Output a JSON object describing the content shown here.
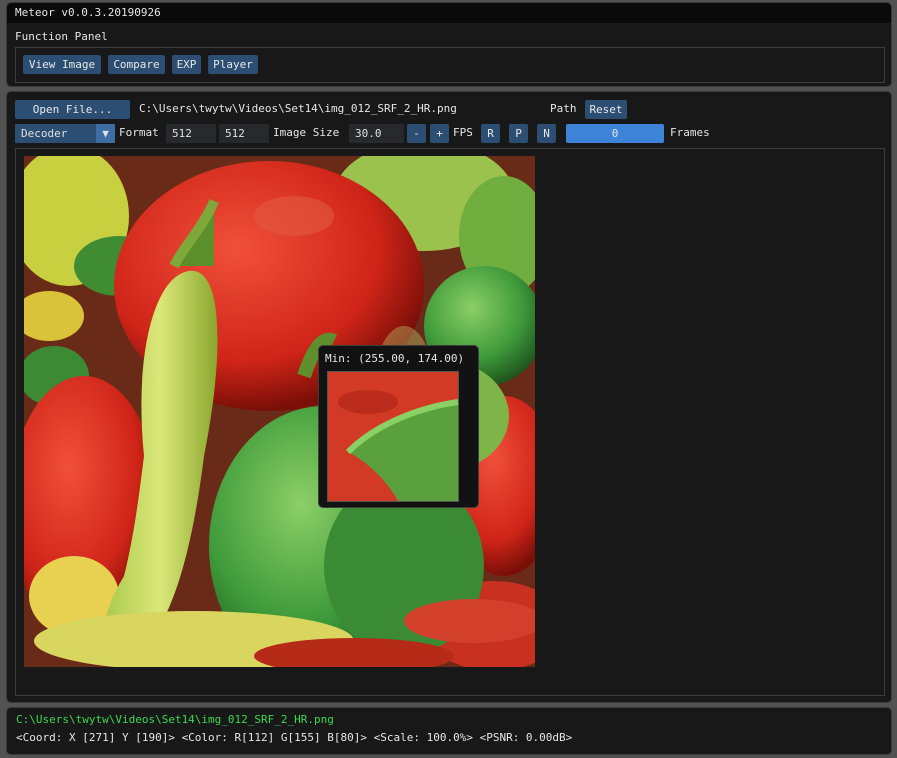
{
  "app": {
    "title": "Meteor v0.0.3.20190926"
  },
  "function_panel": {
    "label": "Function Panel",
    "buttons": [
      "View Image",
      "Compare",
      "EXP",
      "Player"
    ]
  },
  "toolbar": {
    "open_file": "Open File...",
    "path": "C:\\Users\\twytw\\Videos\\Set14\\img_012_SRF_2_HR.png",
    "path_label": "Path",
    "reset": "Reset",
    "decoder": "Decoder",
    "format_label": "Format",
    "width": "512",
    "height": "512",
    "image_size_label": "Image Size",
    "fps_value": "30.0",
    "minus": "-",
    "plus": "+",
    "fps_label": "FPS",
    "r": "R",
    "p": "P",
    "n": "N",
    "frame": "0",
    "frames_label": "Frames"
  },
  "tooltip": {
    "text": "Min: (255.00, 174.00)"
  },
  "status": {
    "path": "C:\\Users\\twytw\\Videos\\Set14\\img_012_SRF_2_HR.png",
    "info": "<Coord: X [271]  Y [190]> <Color: R[112] G[155] B[80]> <Scale: 100.0%> <PSNR: 0.00dB>"
  },
  "colors": {
    "button": "#2c4e72",
    "slider": "#3d84d8",
    "status_path": "#3bd94f",
    "background": "#181818"
  },
  "icons": {
    "combo_arrow": "triangle-down-icon"
  }
}
